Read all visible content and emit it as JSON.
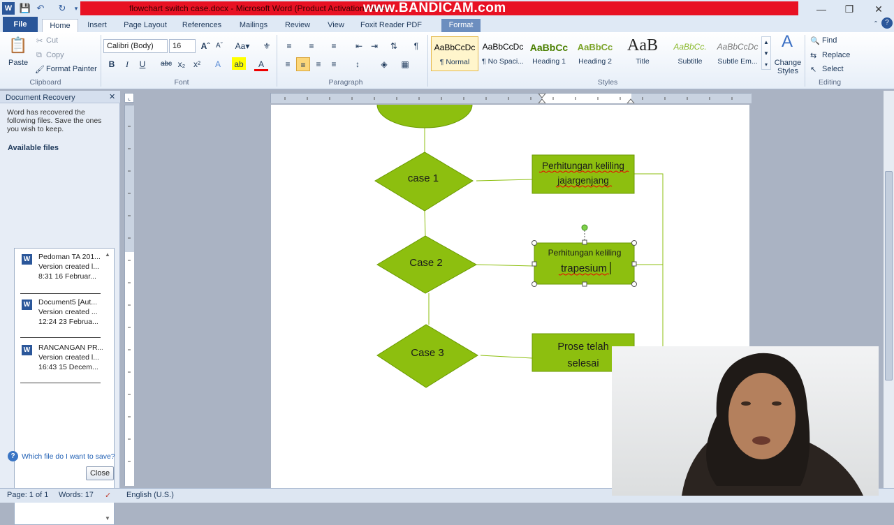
{
  "window": {
    "title": "flowchart switch case.docx - Microsoft Word (Product Activation Failed)",
    "watermark": "www.BANDICAM.com"
  },
  "tabs": [
    "File",
    "Home",
    "Insert",
    "Page Layout",
    "References",
    "Mailings",
    "Review",
    "View",
    "Foxit Reader PDF",
    "Format"
  ],
  "clipboard": {
    "paste": "Paste",
    "cut": "Cut",
    "copy": "Copy",
    "format_painter": "Format Painter",
    "label": "Clipboard"
  },
  "font": {
    "name": "Calibri (Body)",
    "size": "16",
    "label": "Font"
  },
  "paragraph": {
    "label": "Paragraph"
  },
  "styles": {
    "items": [
      {
        "preview": "AaBbCcDc",
        "name": "¶ Normal"
      },
      {
        "preview": "AaBbCcDc",
        "name": "¶ No Spaci..."
      },
      {
        "preview": "AaBbCc",
        "name": "Heading 1"
      },
      {
        "preview": "AaBbCc",
        "name": "Heading 2"
      },
      {
        "preview": "AaB",
        "name": "Title"
      },
      {
        "preview": "AaBbCc.",
        "name": "Subtitle"
      },
      {
        "preview": "AaBbCcDc",
        "name": "Subtle Em..."
      }
    ],
    "change_styles": "Change Styles",
    "label": "Styles"
  },
  "editing": {
    "find": "Find",
    "replace": "Replace",
    "select": "Select",
    "label": "Editing"
  },
  "recovery": {
    "title": "Document Recovery",
    "message": "Word has recovered the following files.  Save the ones you wish to keep.",
    "available": "Available files",
    "files": [
      {
        "name": "Pedoman TA 201...",
        "version": "Version created l...",
        "time": "8:31 16 Februar..."
      },
      {
        "name": "Document5  [Aut...",
        "version": "Version created ...",
        "time": "12:24 23 Februa..."
      },
      {
        "name": "RANCANGAN PR...",
        "version": "Version created l...",
        "time": "16:43 15 Decem..."
      }
    ],
    "help_link": "Which file do I want to save?",
    "close": "Close"
  },
  "flowchart": {
    "case1": "case 1",
    "case2": "Case 2",
    "case3": "Case 3",
    "box1_line1": "Perhitungan keliling",
    "box1_line2": "jajargenjang",
    "box2_line1": "Perhitungan  keliling",
    "box2_line2": "trapesium",
    "box3_line1": "Prose telah",
    "box3_line2": "selesai"
  },
  "status": {
    "page": "Page: 1 of 1",
    "words": "Words: 17",
    "language": "English (U.S.)"
  },
  "colors": {
    "shape_fill": "#8dbf0f",
    "shape_stroke": "#6a9a00",
    "file_tab": "#2a5699",
    "title_red": "#e81123"
  }
}
